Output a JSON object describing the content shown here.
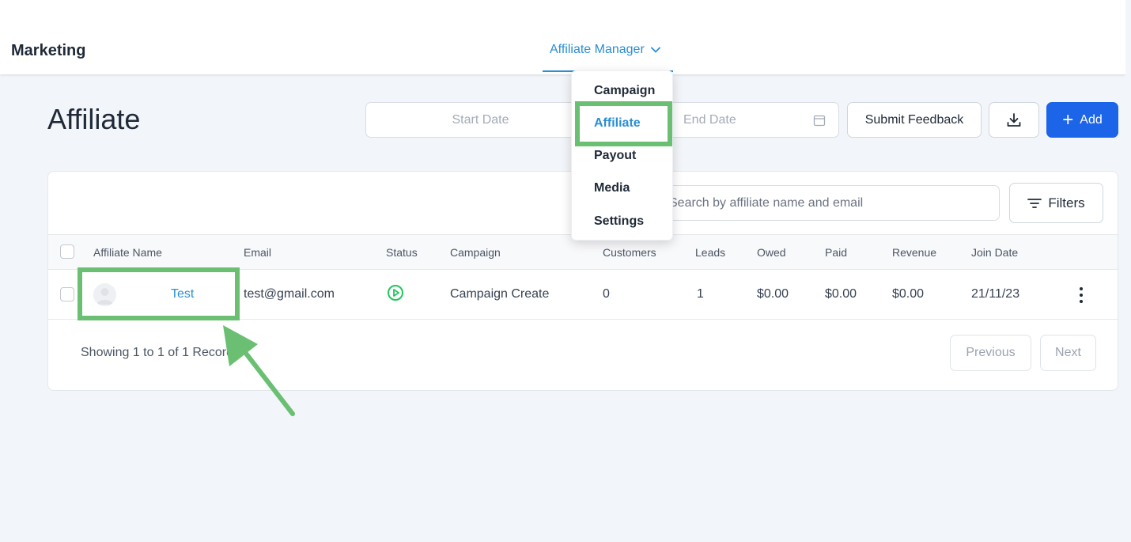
{
  "header": {
    "brand": "Marketing",
    "nav_tab": "Affiliate Manager"
  },
  "page": {
    "title": "Affiliate",
    "start_date_placeholder": "Start Date",
    "end_date_placeholder": "End Date",
    "submit_feedback": "Submit Feedback",
    "add_label": "Add"
  },
  "dropdown": {
    "items": [
      "Campaign",
      "Affiliate",
      "Payout",
      "Media",
      "Settings"
    ],
    "active": "Affiliate"
  },
  "table": {
    "search_placeholder": "Search by affiliate name and email",
    "filters_label": "Filters",
    "columns": [
      "Affiliate Name",
      "Email",
      "Status",
      "Campaign",
      "Customers",
      "Leads",
      "Owed",
      "Paid",
      "Revenue",
      "Join Date"
    ],
    "rows": [
      {
        "name": "Test",
        "email": "test@gmail.com",
        "status": "active",
        "campaign": "Campaign Create",
        "customers": "0",
        "leads": "1",
        "owed": "$0.00",
        "paid": "$0.00",
        "revenue": "$0.00",
        "join_date": "21/11/23"
      }
    ]
  },
  "pagination": {
    "showing": "Showing 1 to 1 of 1 Records",
    "previous": "Previous",
    "next": "Next"
  },
  "colors": {
    "accent": "#2b8fd1",
    "primary_button": "#1c64e8",
    "highlight": "#6abf72",
    "status_active": "#22c55e"
  }
}
